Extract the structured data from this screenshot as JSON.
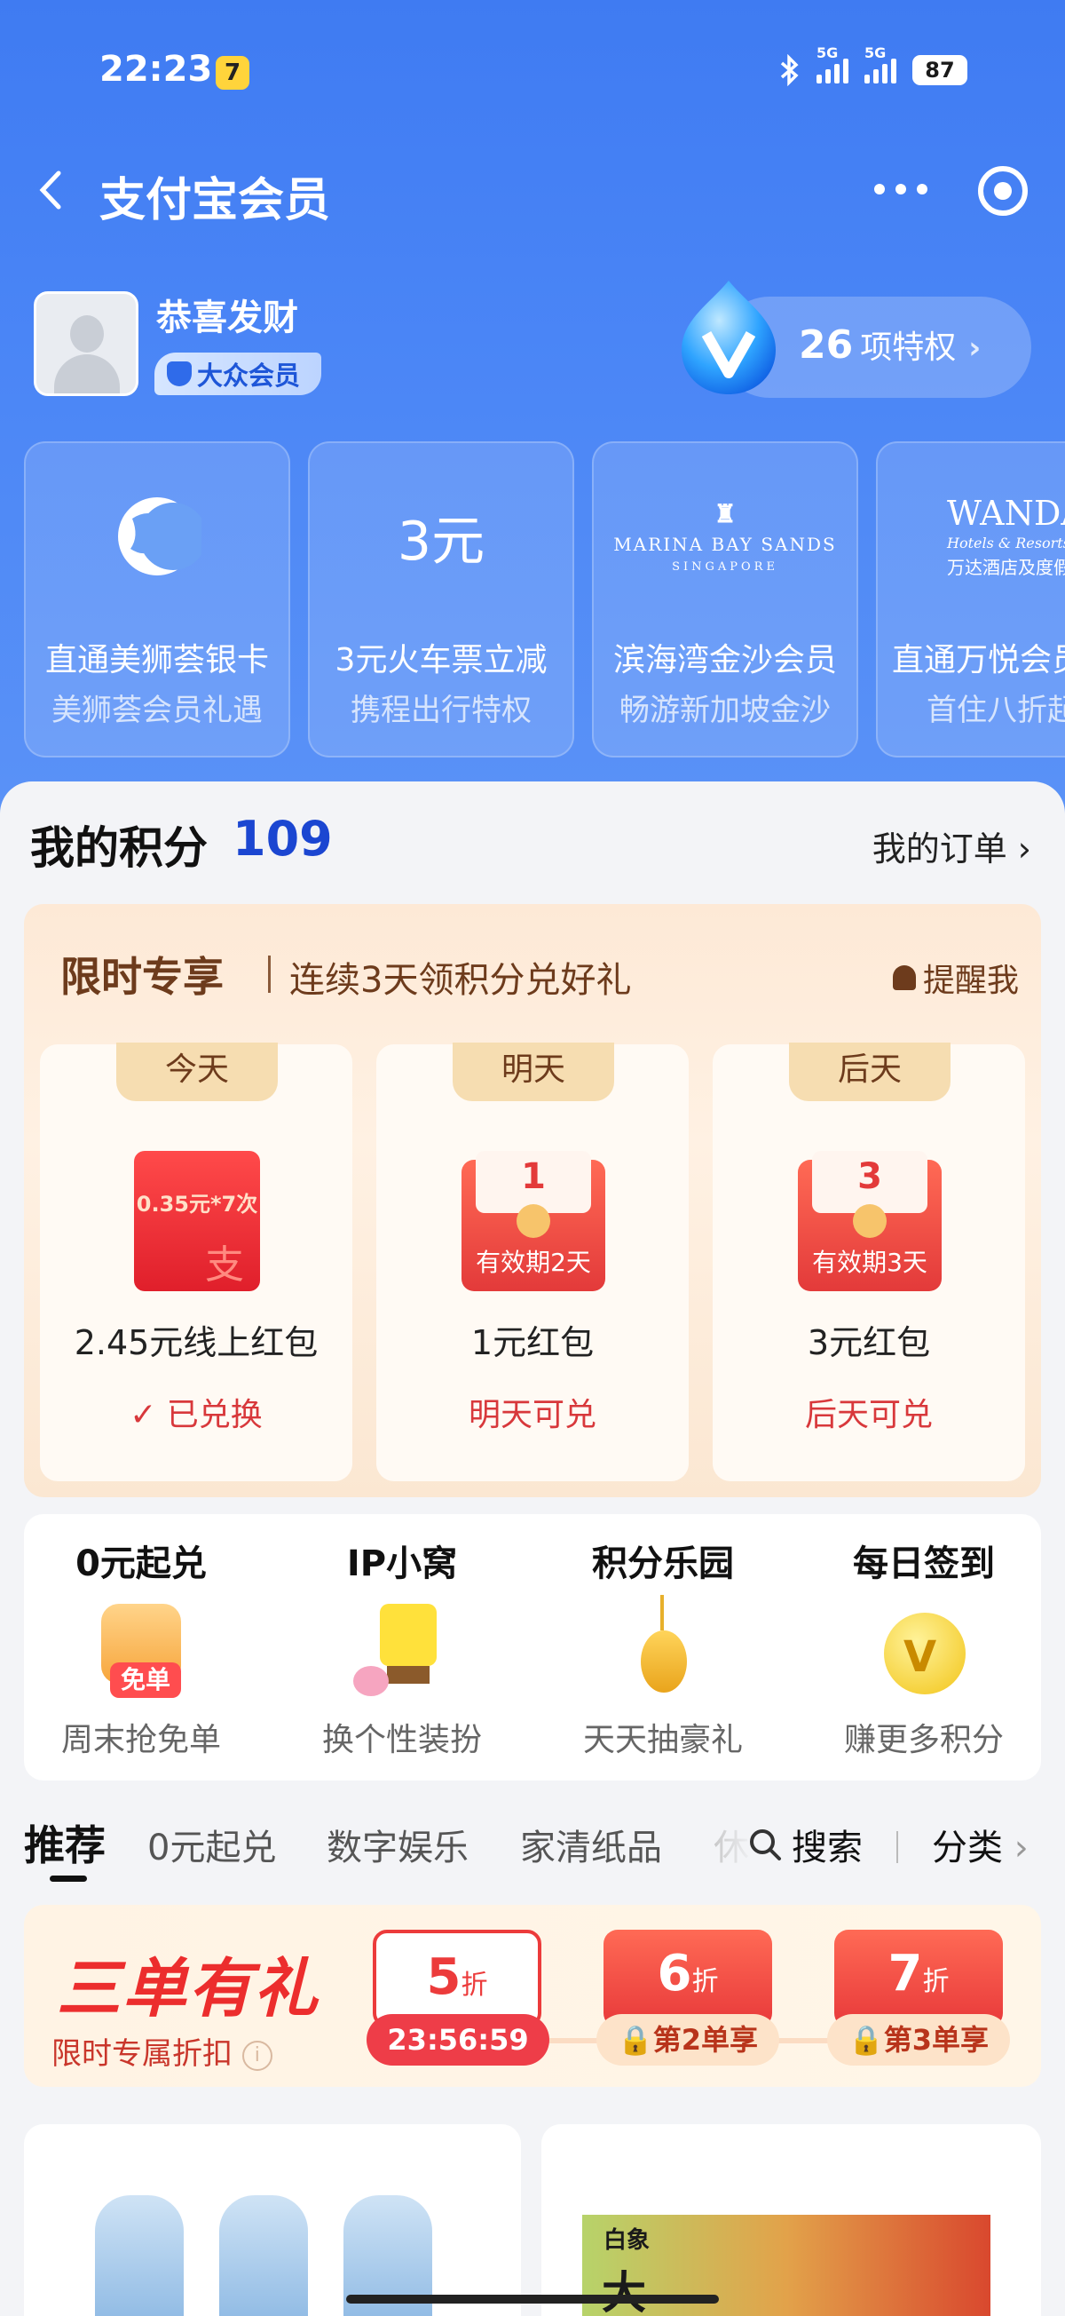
{
  "status_bar": {
    "time": "22:23",
    "app_badge": "7",
    "net1": "5G",
    "net2": "5G",
    "battery": "87"
  },
  "nav": {
    "title": "支付宝会员"
  },
  "user": {
    "name": "恭喜发财",
    "tier": "大众会员",
    "privileges_count": "26",
    "privileges_label": "项特权"
  },
  "benefits": [
    {
      "logo_text": "",
      "title": "直通美狮荟银卡",
      "subtitle": "美狮荟会员礼遇"
    },
    {
      "logo_text": "3元",
      "title": "3元火车票立减",
      "subtitle": "携程出行特权"
    },
    {
      "logo_text": "MARINA BAY SANDS",
      "logo_sub": "SINGAPORE",
      "title": "滨海湾金沙会员",
      "subtitle": "畅游新加坡金沙"
    },
    {
      "logo_text": "WANDA",
      "logo_sub": "Hotels & Resorts",
      "logo_cn": "万达酒店及度假",
      "title": "直通万悦会员",
      "subtitle": "首住八折起"
    }
  ],
  "points": {
    "label": "我的积分",
    "value": "109",
    "orders_label": "我的订单"
  },
  "promo": {
    "title": "限时专享",
    "subtitle": "连续3天领积分兑好礼",
    "remind_label": "提醒我",
    "days": [
      {
        "tab": "今天",
        "packet_label": "0.35元*7次",
        "name": "2.45元线上红包",
        "state": "已兑换"
      },
      {
        "tab": "明天",
        "packet_num": "1",
        "packet_label": "有效期2天",
        "name": "1元红包",
        "state": "明天可兑"
      },
      {
        "tab": "后天",
        "packet_num": "3",
        "packet_label": "有效期3天",
        "name": "3元红包",
        "state": "后天可兑"
      }
    ]
  },
  "features": [
    {
      "title": "0元起兑",
      "badge": "免单",
      "subtitle": "周末抢免单"
    },
    {
      "title": "IP小窝",
      "subtitle": "换个性装扮"
    },
    {
      "title": "积分乐园",
      "subtitle": "天天抽豪礼"
    },
    {
      "title": "每日签到",
      "subtitle": "赚更多积分"
    }
  ],
  "tabs": {
    "items": [
      "推荐",
      "0元起兑",
      "数字娱乐",
      "家清纸品",
      "休"
    ],
    "search": "搜索",
    "category": "分类"
  },
  "three_orders": {
    "title": "三单有礼",
    "subtitle": "限时专属折扣",
    "coupons": [
      {
        "num": "5",
        "unit": "折",
        "pill": "23:56:59"
      },
      {
        "num": "6",
        "unit": "折",
        "pill": "第2单享"
      },
      {
        "num": "7",
        "unit": "折",
        "pill": "第3单享"
      }
    ]
  },
  "products": [
    {
      "brand": ""
    },
    {
      "brand": "白象",
      "name": "大"
    }
  ],
  "colors": {
    "brand_blue": "#3f7bf2",
    "points_blue": "#1b46d1",
    "red": "#ec2d2d",
    "promo_brown": "#6d3b1c"
  }
}
